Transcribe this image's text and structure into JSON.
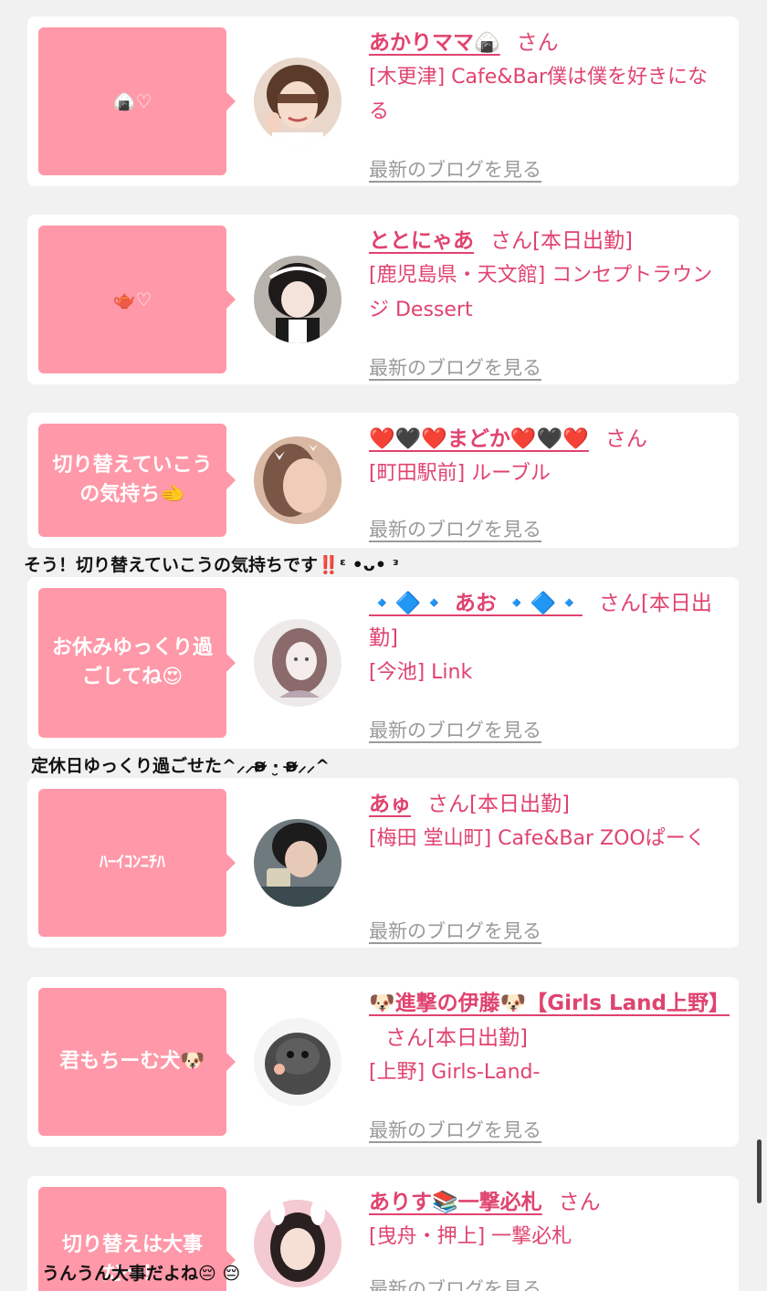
{
  "posts": [
    {
      "bubble": "🍙♡",
      "name": "あかりママ🍙",
      "san": "さん",
      "status": "",
      "shop": "[木更津] Cafe&Bar僕は僕を好きになる",
      "blog_link": "最新のブログを見る"
    },
    {
      "bubble": "🫖♡",
      "name": "ととにゃあ",
      "san": "さん",
      "status": "[本日出勤]",
      "shop": "[鹿児島県・天文館] コンセプトラウンジ Dessert",
      "blog_link": "最新のブログを見る"
    },
    {
      "bubble": "切り替えていこうの気持ち🫲",
      "name": "❤️🖤❤️まどか❤️🖤❤️",
      "san": "さん",
      "status": "",
      "shop": "[町田駅前] ルーブル",
      "blog_link": "最新のブログを見る",
      "reply": "そう！切り替えていこうの気持ちです‼️ᵋ •ᴗ• ᵌ"
    },
    {
      "bubble": "お休みゆっくり過ごしてね😍",
      "name": "🔹🔷🔹 あお 🔹🔷🔹",
      "san": "さん",
      "status": "[本日出勤]",
      "shop": "[今池] Link",
      "blog_link": "最新のブログを見る",
      "reply": "定休日ゆっくり過ごせた^⸝⸝ʚ̴̶̷̷ ·̮ ʚ̴̶̷̷⸝⸝^"
    },
    {
      "bubble": "ﾊｰｲｺﾝﾆﾁﾊ",
      "name": "あゅ",
      "san": "さん",
      "status": "[本日出勤]",
      "shop": "[梅田 堂山町] Cafe&Bar ZOOぱーく",
      "blog_link": "最新のブログを見る"
    },
    {
      "bubble": "君もちーむ犬🐶",
      "name": "🐶進撃の伊藤🐶【Girls Land上野】",
      "san": "さん",
      "status": "[本日出勤]",
      "shop": "[上野] Girls-Land-",
      "blog_link": "最新のブログを見る"
    },
    {
      "bubble": "切り替えは大事だ〜！",
      "name": "ありす📚一撃必札",
      "san": "さん",
      "status": "",
      "shop": "[曳舟・押上] 一撃必札",
      "blog_link": "最新のブログを見る",
      "reply": "うんうん大事だよね😔 😔"
    }
  ],
  "colors": {
    "bubble": "#ff98a8",
    "accent": "#e0436e",
    "link_gray": "#9a9a9a",
    "background": "#f1f1f1"
  }
}
